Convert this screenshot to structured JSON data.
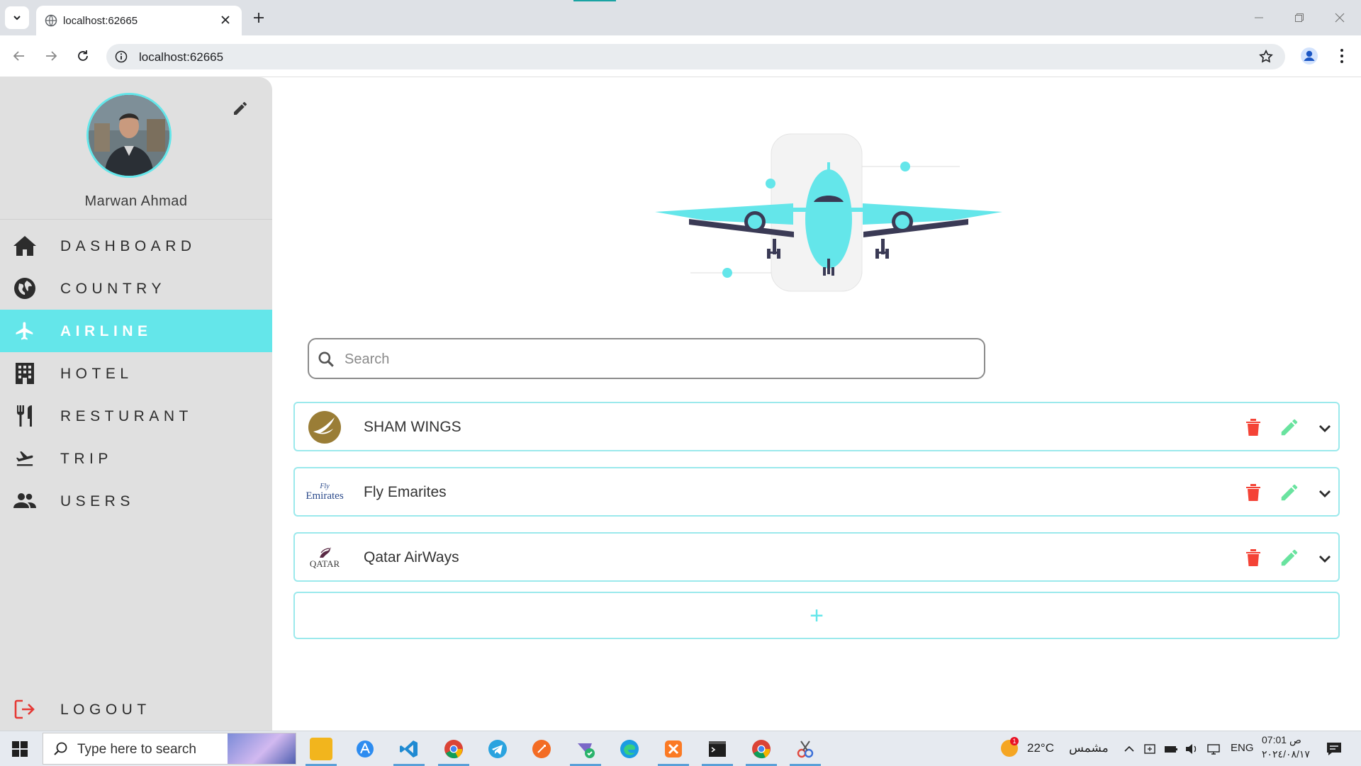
{
  "browser": {
    "tab_title": "localhost:62665",
    "url": "localhost:62665"
  },
  "sidebar": {
    "user_name": "Marwan Ahmad",
    "items": [
      {
        "label": "DASHBOARD",
        "icon": "home-icon"
      },
      {
        "label": "COUNTRY",
        "icon": "globe-icon"
      },
      {
        "label": "AIRLINE",
        "icon": "airplane-icon",
        "active": true
      },
      {
        "label": "HOTEL",
        "icon": "building-icon"
      },
      {
        "label": "RESTURANT",
        "icon": "restaurant-icon"
      },
      {
        "label": "TRIP",
        "icon": "flight-takeoff-icon"
      },
      {
        "label": "USERS",
        "icon": "people-icon"
      }
    ],
    "logout_label": "LOGOUT"
  },
  "main": {
    "search_placeholder": "Search",
    "airlines": [
      {
        "name": "SHAM WINGS",
        "logo": "sham-wings-logo"
      },
      {
        "name": "Fly Emarites",
        "logo": "emirates-logo",
        "logo_text_small": "Fly",
        "logo_text": "Emirates"
      },
      {
        "name": "Qatar AirWays",
        "logo": "qatar-logo",
        "logo_text": "QATAR"
      }
    ],
    "add_label": "+"
  },
  "taskbar": {
    "search_placeholder": "Type here to search",
    "weather_temp": "22°C",
    "weather_desc": "مشمس",
    "weather_badge": "1",
    "language": "ENG",
    "time": "07:01 ص",
    "date": "٢٠٢٤/٠٨/١٧"
  },
  "colors": {
    "accent": "#64e6ea",
    "delete": "#f44336",
    "edit": "#69e39f",
    "sidebar_bg": "#e0e0e0"
  }
}
